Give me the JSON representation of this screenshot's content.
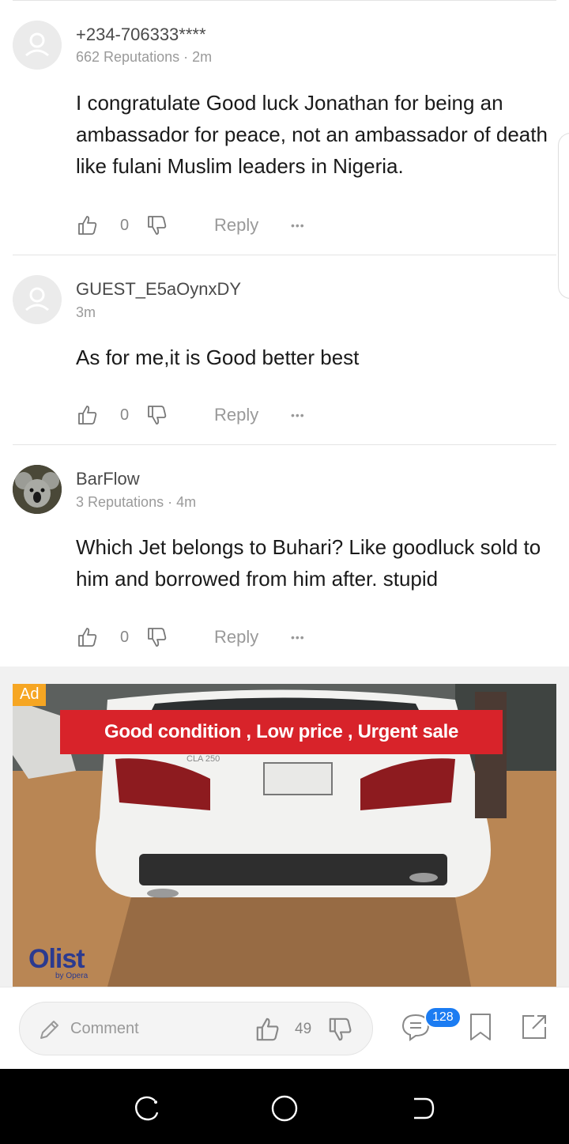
{
  "comments": [
    {
      "user": "+234-706333****",
      "meta": "662 Reputations · 2m",
      "text": "I congratulate Good luck Jonathan for being an ambassador for peace, not an ambassador of death like fulani Muslim leaders in Nigeria.",
      "likes": "0",
      "reply_label": "Reply",
      "more_label": "•••",
      "avatar": "default-avatar-icon"
    },
    {
      "user": "GUEST_E5aOynxDY",
      "meta": "3m",
      "text": "As for me,it is Good better best",
      "likes": "0",
      "reply_label": "Reply",
      "more_label": "•••",
      "avatar": "default-avatar-icon"
    },
    {
      "user": "BarFlow",
      "meta": "3 Reputations · 4m",
      "text": "Which Jet belongs to Buhari? Like goodluck sold to him and borrowed from him after. stupid",
      "likes": "0",
      "reply_label": "Reply",
      "more_label": "•••",
      "avatar": "koala-avatar-photo"
    }
  ],
  "ad": {
    "badge": "Ad",
    "banner": "Good condition , Low price , Urgent sale",
    "logo": "Olist",
    "logo_sub": "by Opera",
    "plate": "CLA 250"
  },
  "bottom_bar": {
    "comment_placeholder": "Comment",
    "likes": "49",
    "comments_badge": "128",
    "icons": [
      "pencil-icon",
      "thumbs-up-icon",
      "thumbs-down-icon",
      "comments-icon",
      "bookmark-icon",
      "share-icon"
    ]
  },
  "colors": {
    "accent_blue": "#1b7cf2",
    "ad_badge": "#f6a623",
    "ad_banner": "#d8232a"
  }
}
